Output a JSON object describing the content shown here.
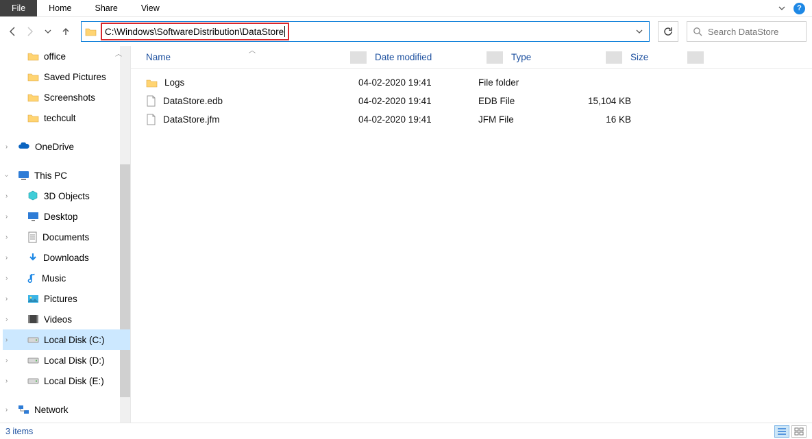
{
  "ribbon": {
    "file": "File",
    "home": "Home",
    "share": "Share",
    "view": "View"
  },
  "address": {
    "path": "C:\\Windows\\SoftwareDistribution\\DataStore"
  },
  "search": {
    "placeholder": "Search DataStore"
  },
  "sidebar": {
    "folders": [
      {
        "label": "office"
      },
      {
        "label": "Saved Pictures"
      },
      {
        "label": "Screenshots"
      },
      {
        "label": "techcult"
      }
    ],
    "onedrive": "OneDrive",
    "thispc": "This PC",
    "pcitems": [
      {
        "label": "3D Objects",
        "icon": "cube"
      },
      {
        "label": "Desktop",
        "icon": "desktop"
      },
      {
        "label": "Documents",
        "icon": "doc"
      },
      {
        "label": "Downloads",
        "icon": "down"
      },
      {
        "label": "Music",
        "icon": "music"
      },
      {
        "label": "Pictures",
        "icon": "pic"
      },
      {
        "label": "Videos",
        "icon": "video"
      },
      {
        "label": "Local Disk (C:)",
        "icon": "disk",
        "selected": true
      },
      {
        "label": "Local Disk (D:)",
        "icon": "disk"
      },
      {
        "label": "Local Disk (E:)",
        "icon": "disk"
      }
    ],
    "network": "Network"
  },
  "columns": {
    "name": "Name",
    "modified": "Date modified",
    "type": "Type",
    "size": "Size"
  },
  "files": [
    {
      "name": "Logs",
      "modified": "04-02-2020 19:41",
      "type": "File folder",
      "size": "",
      "icon": "folder"
    },
    {
      "name": "DataStore.edb",
      "modified": "04-02-2020 19:41",
      "type": "EDB File",
      "size": "15,104 KB",
      "icon": "file"
    },
    {
      "name": "DataStore.jfm",
      "modified": "04-02-2020 19:41",
      "type": "JFM File",
      "size": "16 KB",
      "icon": "file"
    }
  ],
  "status": {
    "count": "3 items"
  }
}
